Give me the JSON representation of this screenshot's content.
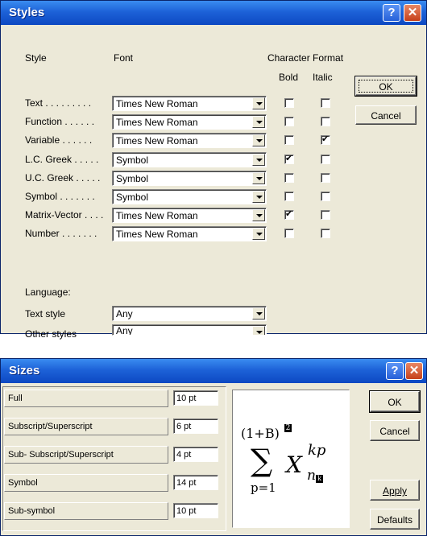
{
  "styles": {
    "title": "Styles",
    "help_label": "?",
    "close_label": "✕",
    "headers": {
      "style": "Style",
      "font": "Font",
      "char_format": "Character Format",
      "bold": "Bold",
      "italic": "Italic"
    },
    "rows": [
      {
        "label": "Text",
        "dots": " . . . . . . . . .",
        "font": "Times New Roman",
        "bold": false,
        "italic": false
      },
      {
        "label": "Function",
        "dots": " . . . . . .",
        "font": "Times New Roman",
        "bold": false,
        "italic": false
      },
      {
        "label": "Variable",
        "dots": " . . . . . .",
        "font": "Times New Roman",
        "bold": false,
        "italic": true
      },
      {
        "label": "L.C. Greek",
        "dots": " . . . . .",
        "font": "Symbol",
        "bold": true,
        "italic": false
      },
      {
        "label": "U.C. Greek",
        "dots": " . . . . .",
        "font": "Symbol",
        "bold": false,
        "italic": false
      },
      {
        "label": "Symbol",
        "dots": " . . . . . . .",
        "font": "Symbol",
        "bold": false,
        "italic": false
      },
      {
        "label": "Matrix-Vector",
        "dots": " . . . .",
        "font": "Times New Roman",
        "bold": true,
        "italic": false
      },
      {
        "label": "Number",
        "dots": " . . . . . . .",
        "font": "Times New Roman",
        "bold": false,
        "italic": false
      }
    ],
    "language_label": "Language:",
    "text_style_label": "Text style",
    "text_style_value": "Any",
    "other_styles_label": "Other styles",
    "other_styles_value": "Any",
    "ok_label": "OK",
    "cancel_label": "Cancel"
  },
  "sizes": {
    "title": "Sizes",
    "help_label": "?",
    "close_label": "✕",
    "rows": [
      {
        "label": "Full",
        "value": "10 pt"
      },
      {
        "label": "Subscript/Superscript",
        "value": "6 pt"
      },
      {
        "label": "Sub- Subscript/Superscript",
        "value": "4 pt"
      },
      {
        "label": "Symbol",
        "value": "14 pt"
      },
      {
        "label": "Sub-symbol",
        "value": "10 pt"
      }
    ],
    "preview": {
      "top": "(1+B)",
      "sup_marker": "2",
      "sigma": "∑",
      "base": "X",
      "superscript": "kp",
      "subscript": "n",
      "subsub_marker": "k",
      "limit": "p=1"
    },
    "ok_label": "OK",
    "cancel_label": "Cancel",
    "apply_label": "Apply",
    "defaults_label": "Defaults"
  }
}
